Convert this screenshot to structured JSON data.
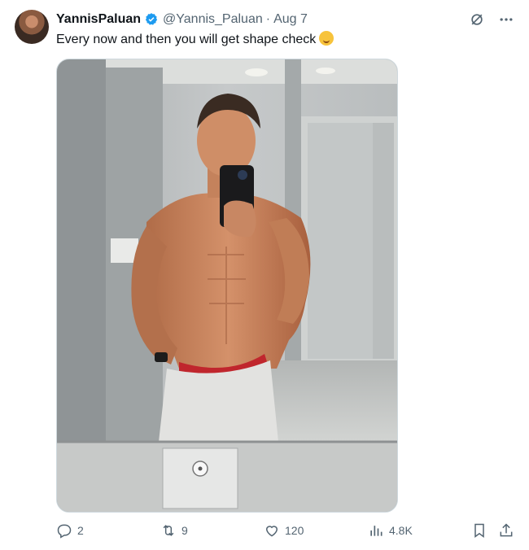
{
  "author": {
    "display_name": "YannisPaluan",
    "handle": "@Yannis_Paluan",
    "date": "Aug 7"
  },
  "tweet": {
    "text": "Every now and then you will get shape check"
  },
  "actions": {
    "replies": "2",
    "retweets": "9",
    "likes": "120",
    "views": "4.8K"
  },
  "colors": {
    "verified": "#1d9bf0",
    "icon": "#536471",
    "text": "#0f1419"
  },
  "icons": [
    "grok-icon",
    "more-icon",
    "reply-icon",
    "retweet-icon",
    "like-icon",
    "views-icon",
    "bookmark-icon",
    "share-icon"
  ]
}
